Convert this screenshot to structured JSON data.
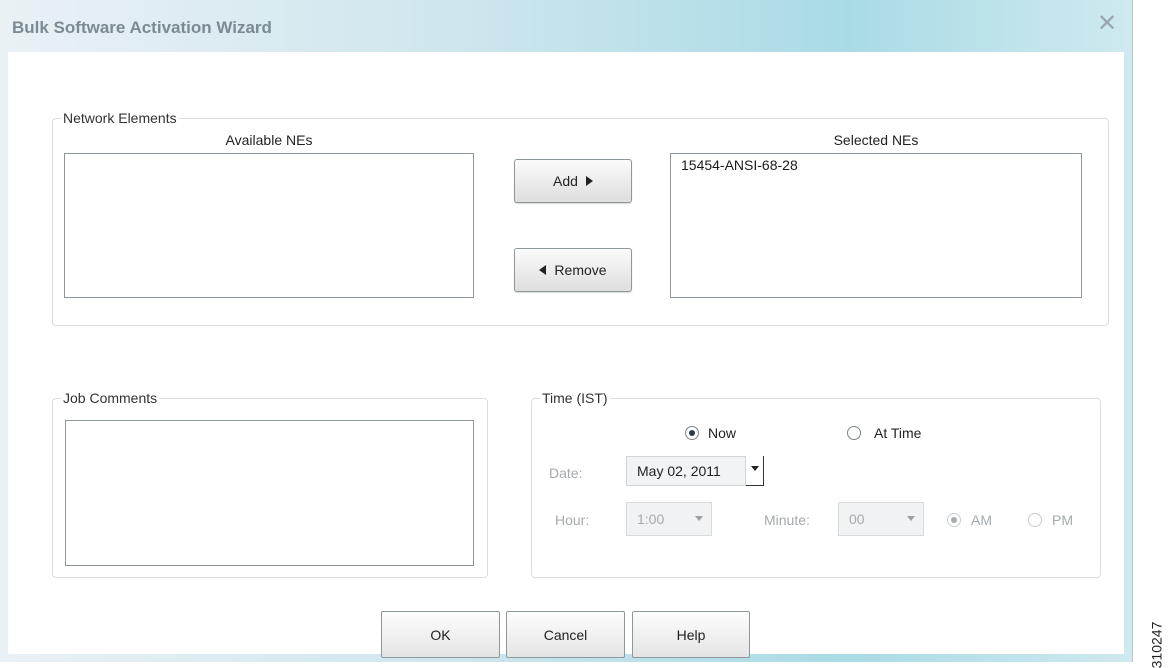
{
  "window": {
    "title": "Bulk Software Activation Wizard",
    "close_glyph": "✕"
  },
  "network_elements": {
    "legend": "Network Elements",
    "available_header": "Available NEs",
    "selected_header": "Selected NEs",
    "available_items": [],
    "selected_items": [
      "15454-ANSI-68-28"
    ],
    "add_label": "Add",
    "remove_label": "Remove"
  },
  "job_comments": {
    "legend": "Job Comments",
    "value": ""
  },
  "time": {
    "legend": "Time (IST)",
    "now_label": "Now",
    "now_selected": true,
    "at_time_label": "At Time",
    "date_label": "Date:",
    "date_value": "May 02, 2011",
    "hour_label": "Hour:",
    "hour_value": "1:00",
    "minute_label": "Minute:",
    "minute_value": "00",
    "am_label": "AM",
    "pm_label": "PM",
    "am_selected": true
  },
  "footer": {
    "ok_label": "OK",
    "cancel_label": "Cancel",
    "help_label": "Help"
  },
  "figure_id": "310247"
}
